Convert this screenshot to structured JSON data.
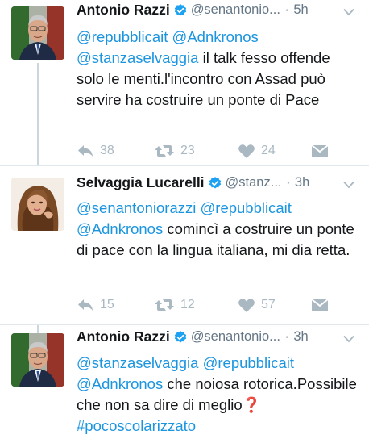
{
  "tweets": [
    {
      "name": "Antonio Razzi",
      "handle": "@senantonio...",
      "separator": "·",
      "time": "5h",
      "text": {
        "mentions": "@repubblicait @Adnkronos",
        "mention2": "@stanzaselvaggia",
        "rest": " il talk fesso offende solo le menti.l'incontro con Assad può servire ha costruire un ponte di Pace"
      },
      "actions": {
        "reply": "38",
        "retweet": "23",
        "like": "24"
      }
    },
    {
      "name": "Selvaggia Lucarelli",
      "handle": "@stanz...",
      "separator": "·",
      "time": "3h",
      "text": {
        "mentions": "@senantoniorazzi @repubblicait",
        "mention2": "@Adnkronos",
        "rest": " comincì a costruire un ponte di pace con la lingua italiana, mi dia retta."
      },
      "actions": {
        "reply": "15",
        "retweet": "12",
        "like": "57"
      }
    },
    {
      "name": "Antonio Razzi",
      "handle": "@senantonio...",
      "separator": "·",
      "time": "3h",
      "text": {
        "mentions": "@stanzaselvaggia @repubblicait",
        "mention2": "@Adnkronos",
        "rest": " che noiosa rotorica.Possibile che non sa dire di meglio",
        "emoji": "❓",
        "hashtag": "#pocoscolarizzato"
      }
    }
  ],
  "colors": {
    "link": "#1b95e0",
    "verified": "#1da1f2",
    "muted": "#657786",
    "action": "#aab8c2",
    "thread": "#ccd6dd"
  },
  "icons": [
    "reply-icon",
    "retweet-icon",
    "like-icon",
    "dm-icon",
    "verified-icon",
    "chevron-down-icon"
  ]
}
